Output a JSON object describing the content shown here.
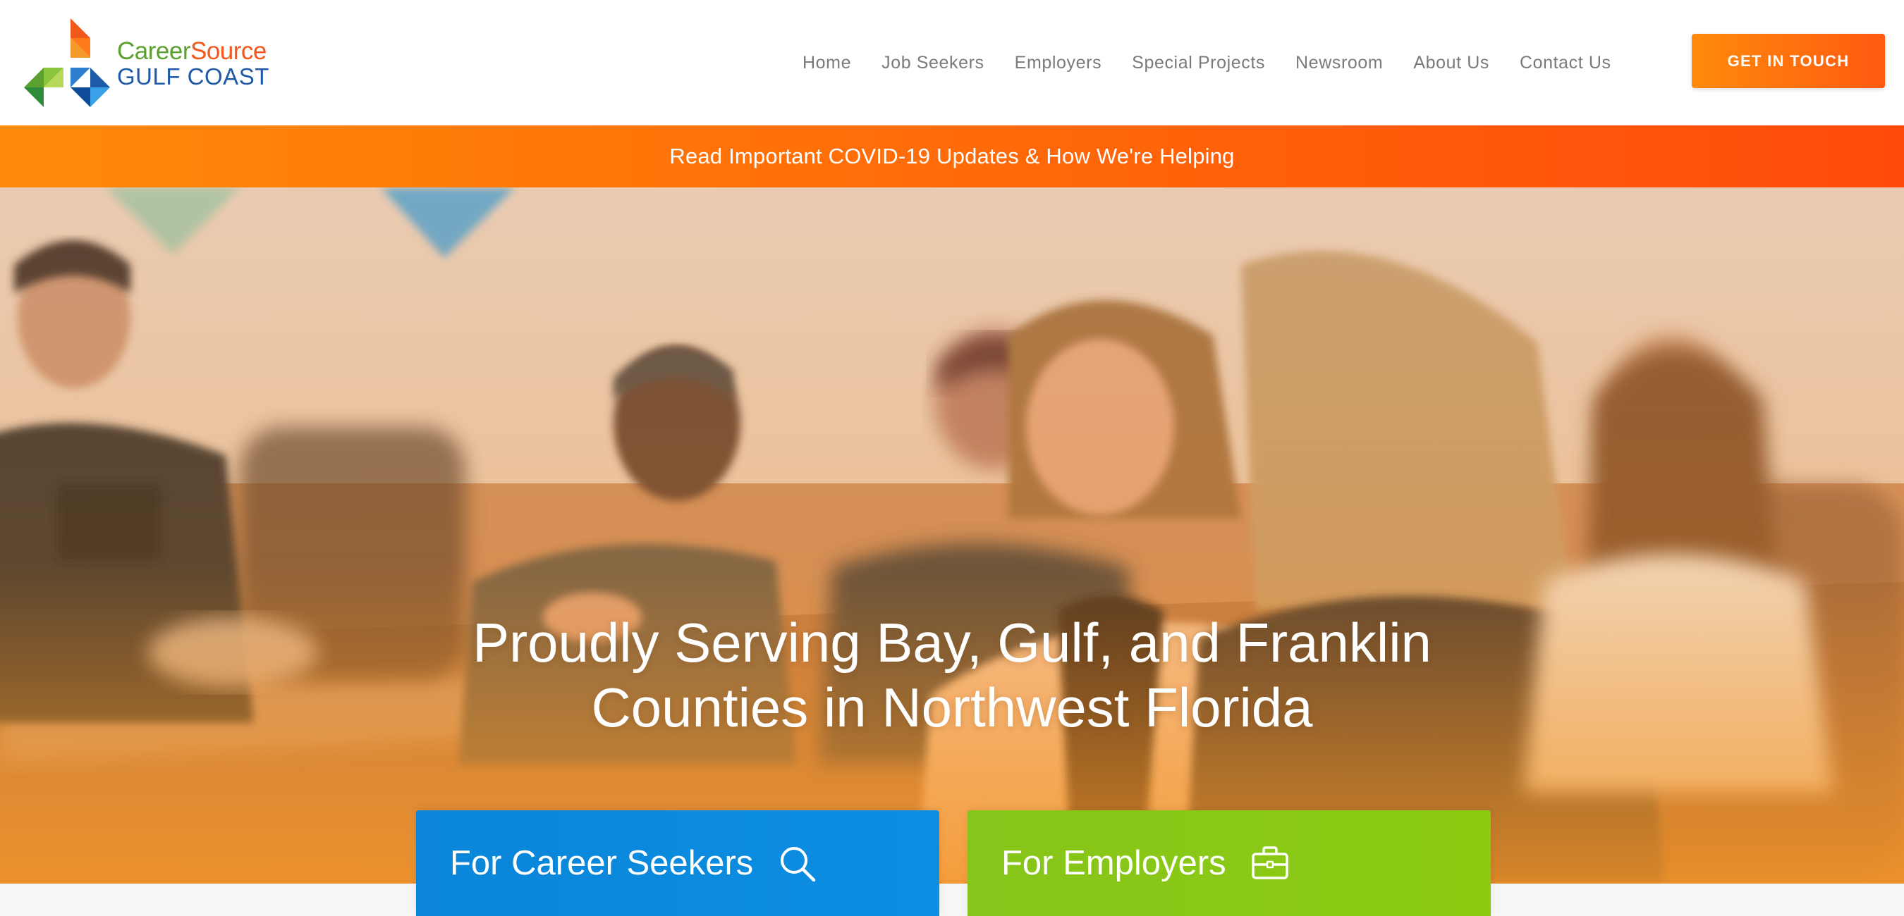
{
  "brand": {
    "name_part1": "Career",
    "name_part2": "Source",
    "name_line2": "GULF COAST"
  },
  "nav": {
    "items": [
      {
        "label": "Home"
      },
      {
        "label": "Job Seekers"
      },
      {
        "label": "Employers"
      },
      {
        "label": "Special Projects"
      },
      {
        "label": "Newsroom"
      },
      {
        "label": "About Us"
      },
      {
        "label": "Contact Us"
      }
    ],
    "cta_label": "GET IN TOUCH"
  },
  "alert": {
    "text": "Read Important COVID-19 Updates & How We're Helping"
  },
  "hero": {
    "heading_line1": "Proudly Serving Bay, Gulf, and Franklin",
    "heading_line2": "Counties in Northwest Florida"
  },
  "cards": [
    {
      "label": "For Career Seekers",
      "icon": "search-icon",
      "color": "#0a85d9"
    },
    {
      "label": "For Employers",
      "icon": "briefcase-icon",
      "color": "#86c51a"
    }
  ],
  "colors": {
    "accent_orange": "#ff6e08",
    "brand_blue": "#1e5aa8",
    "brand_green": "#5aa12f",
    "nav_text": "#7a7a7a"
  }
}
